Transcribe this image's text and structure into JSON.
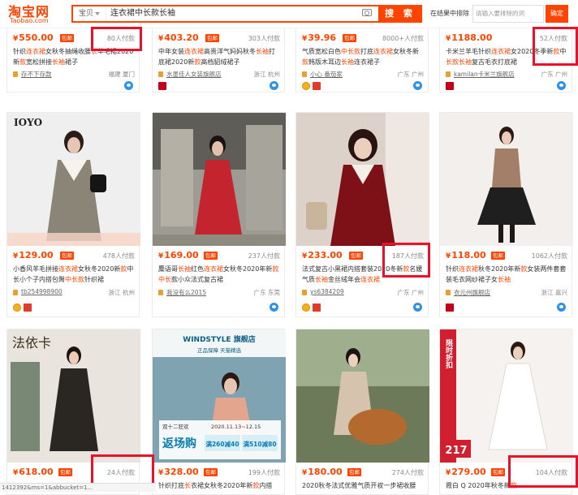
{
  "colors": {
    "accent": "#ff4400",
    "highlight_box": "#e8122a"
  },
  "header": {
    "logo_main": "淘宝网",
    "logo_sub": "Taobao.com",
    "search_category": "宝贝",
    "search_query": "连衣裙中长款长袖",
    "search_button": "搜 索",
    "within_label": "在结果中排除",
    "within_placeholder": "请输入要排除的词",
    "within_button": "确定"
  },
  "row1": [
    {
      "yen": "¥",
      "price": "550.00",
      "badge": "包邮",
      "paid": "80人付款",
      "title": [
        {
          "t": "针织"
        },
        {
          "t": "连衣裙",
          "h": 1
        },
        {
          "t": "女秋冬抽绳收腰"
        },
        {
          "t": "长",
          "h": 1
        },
        {
          "t": "羊毛裙"
        },
        {
          "t": "2020新"
        },
        {
          "t": "款",
          "h": 1
        },
        {
          "t": "宽松拼接"
        },
        {
          "t": "长袖",
          "h": 1
        },
        {
          "t": "裙子"
        }
      ],
      "shop": "存不下存款",
      "loc": "福建 厦门"
    },
    {
      "yen": "¥",
      "price": "403.20",
      "badge": "包邮",
      "paid": "303人付款",
      "title": [
        {
          "t": "中年女装"
        },
        {
          "t": "连衣裙",
          "h": 1
        },
        {
          "t": "高贵洋气妈妈秋冬"
        },
        {
          "t": "长袖",
          "h": 1
        },
        {
          "t": "打底裙2020新"
        },
        {
          "t": "款",
          "h": 1
        },
        {
          "t": "高档貂绒裙子"
        }
      ],
      "shop": "水墨佳人女装旗舰店",
      "loc": "浙江 杭州"
    },
    {
      "yen": "¥",
      "price": "39.96",
      "badge": "包邮",
      "paid": "8000+人付款",
      "title": [
        {
          "t": "气质宽松白色"
        },
        {
          "t": "中长款",
          "h": 1
        },
        {
          "t": "打底"
        },
        {
          "t": "连衣裙",
          "h": 1
        },
        {
          "t": "女秋冬新"
        },
        {
          "t": "款",
          "h": 1
        },
        {
          "t": "韩版木耳边"
        },
        {
          "t": "长袖",
          "h": 1
        },
        {
          "t": "连衣裙子"
        }
      ],
      "shop": "小心 番茄家",
      "loc": "广东 广州"
    },
    {
      "yen": "¥",
      "price": "1188.00",
      "badge": "",
      "paid": "52人付款",
      "title": [
        {
          "t": "卡米兰羊毛针织"
        },
        {
          "t": "连衣裙",
          "h": 1
        },
        {
          "t": "女2020冬季新"
        },
        {
          "t": "款",
          "h": 1
        },
        {
          "t": "中"
        },
        {
          "t": "长款长袖",
          "h": 1
        },
        {
          "t": "复古毛衣打底裙"
        }
      ],
      "shop": "kamilan卡米兰旗舰店",
      "loc": "广东 广州"
    }
  ],
  "row2": [
    {
      "img_text": "IOYO",
      "yen": "¥",
      "price": "129.00",
      "badge": "包邮",
      "paid": "478人付款",
      "title": [
        {
          "t": "小香风羊毛拼接"
        },
        {
          "t": "连衣裙",
          "h": 1
        },
        {
          "t": "女秋冬2020新"
        },
        {
          "t": "款",
          "h": 1
        },
        {
          "t": "中长"
        },
        {
          "t": "小个子内搭包臀"
        },
        {
          "t": "中长款",
          "h": 1
        },
        {
          "t": "针织裙"
        }
      ],
      "shop": "tb254998900",
      "loc": "浙江 杭州"
    },
    {
      "yen": "¥",
      "price": "169.00",
      "badge": "包邮",
      "paid": "237人付款",
      "title": [
        {
          "t": "麋语哥"
        },
        {
          "t": "长袖",
          "h": 1
        },
        {
          "t": "红色"
        },
        {
          "t": "连衣裙",
          "h": 1
        },
        {
          "t": "女秋冬2020年新"
        },
        {
          "t": "款",
          "h": 1
        },
        {
          "t": "中长",
          "h": 1
        },
        {
          "t": "款小众法式复古裙"
        }
      ],
      "shop": "我没有么2015",
      "loc": "广东 东莞"
    },
    {
      "yen": "¥",
      "price": "233.00",
      "badge": "包邮",
      "paid": "187人付款",
      "title": [
        {
          "t": "法式复古小黑裙内搭套装2020冬新"
        },
        {
          "t": "款",
          "h": 1
        },
        {
          "t": "名媛"
        },
        {
          "t": "气质"
        },
        {
          "t": "长袖",
          "h": 1
        },
        {
          "t": "金丝绒年会"
        },
        {
          "t": "连衣裙",
          "h": 1
        }
      ],
      "shop": "ys6384209",
      "loc": "广东 广州"
    },
    {
      "yen": "¥",
      "price": "118.00",
      "badge": "包邮",
      "paid": "1062人付款",
      "title": [
        {
          "t": "针织"
        },
        {
          "t": "连衣裙",
          "h": 1
        },
        {
          "t": "秋冬2020年新"
        },
        {
          "t": "款",
          "h": 1
        },
        {
          "t": "女装两件套"
        },
        {
          "t": "套装"
        },
        {
          "t": "毛衣"
        },
        {
          "t": "网纱裙子女"
        },
        {
          "t": "长袖",
          "h": 1
        }
      ],
      "shop": "衣元州旗舰店",
      "loc": "浙江 嘉兴"
    }
  ],
  "row3": [
    {
      "img_text": "法依卡",
      "yen": "¥",
      "price": "618.00",
      "badge": "包邮",
      "paid": "24人付款"
    },
    {
      "banner_brand": "WINDSTYLE 旗舰店",
      "banner_sub": "正品保障  天猫精选",
      "banner_date": "2020.11.13~12.15",
      "banner_big": "返场购",
      "banner_c1": "满260减40",
      "banner_c2": "满510减80",
      "banner_top": "双十二狂欢",
      "yen": "¥",
      "price": "328.00",
      "badge": "包邮",
      "paid": "199人付款",
      "title": [
        {
          "t": "针织打底"
        },
        {
          "t": "长",
          "h": 1
        },
        {
          "t": "衣裙女秋冬2020年新"
        },
        {
          "t": "款",
          "h": 1
        },
        {
          "t": "内搭"
        }
      ]
    },
    {
      "yen": "¥",
      "price": "180.00",
      "badge": "包邮",
      "paid": "274人付款",
      "title": [
        {
          "t": "2020秋冬法式优雅气质开衩一步裙收腰"
        }
      ]
    },
    {
      "banner_vert": "限时折扣",
      "banner_price": "217",
      "yen": "¥",
      "price": "279.00",
      "badge": "包邮",
      "paid": "104人付款",
      "title": [
        {
          "t": "霞白 Q 2020年秋冬新"
        },
        {
          "t": "款",
          "h": 1
        }
      ]
    }
  ],
  "url_text": "1412392&ms=1&abbucket=1..."
}
